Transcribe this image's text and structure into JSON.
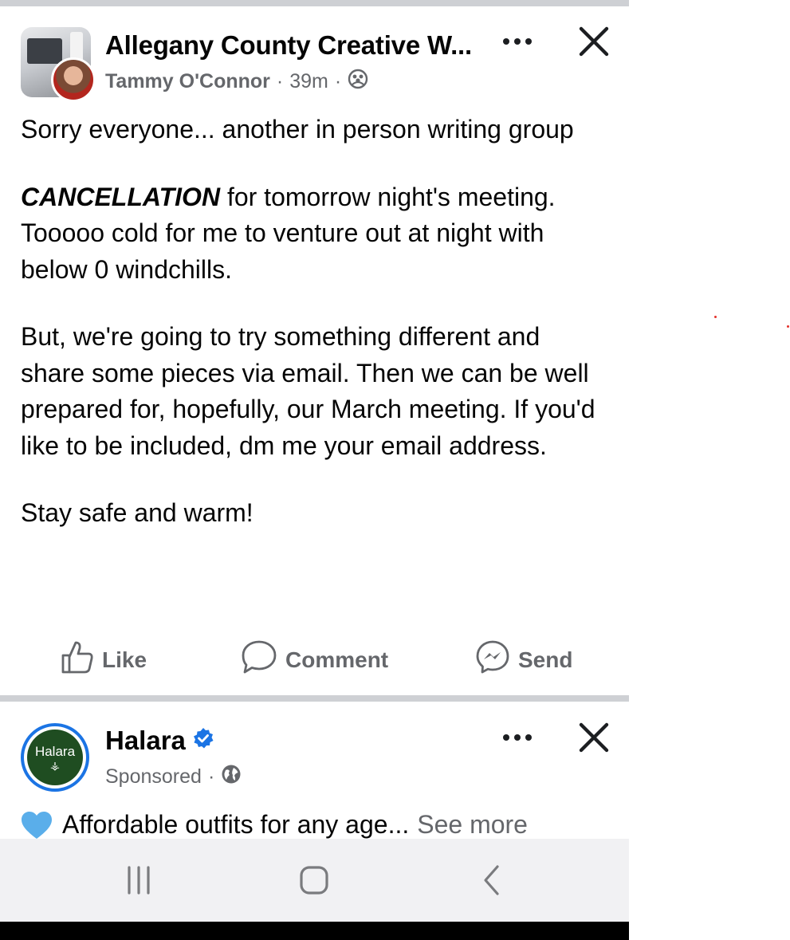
{
  "post": {
    "group_name": "Allegany County Creative W...",
    "author": "Tammy O'Connor",
    "separator": "·",
    "time": "39m",
    "audience_icon": "group-audience-icon",
    "body": {
      "p1": "Sorry everyone... another in person writing group",
      "p2_emphasis": "CANCELLATION",
      "p2_rest": " for tomorrow night's meeting. Tooooo cold for me to venture out at night with below 0 windchills.",
      "p3": "But, we're going to try something different and share some pieces via email. Then we can be well prepared for, hopefully, our March meeting. If you'd like to be included, dm me your email address.",
      "p4": "Stay safe and warm!"
    },
    "actions": {
      "like": "Like",
      "comment": "Comment",
      "send": "Send"
    }
  },
  "ad": {
    "name": "Halara",
    "avatar_text": "Halara",
    "sponsored": "Sponsored",
    "separator": "·",
    "text": "Affordable outfits for any age...",
    "see_more": "See more"
  },
  "colors": {
    "divider": "#ced0d4",
    "secondary_text": "#65676b",
    "verified_blue": "#1b74e4",
    "halara_green": "#1f4d21",
    "navbar": "#f1f1f3"
  }
}
